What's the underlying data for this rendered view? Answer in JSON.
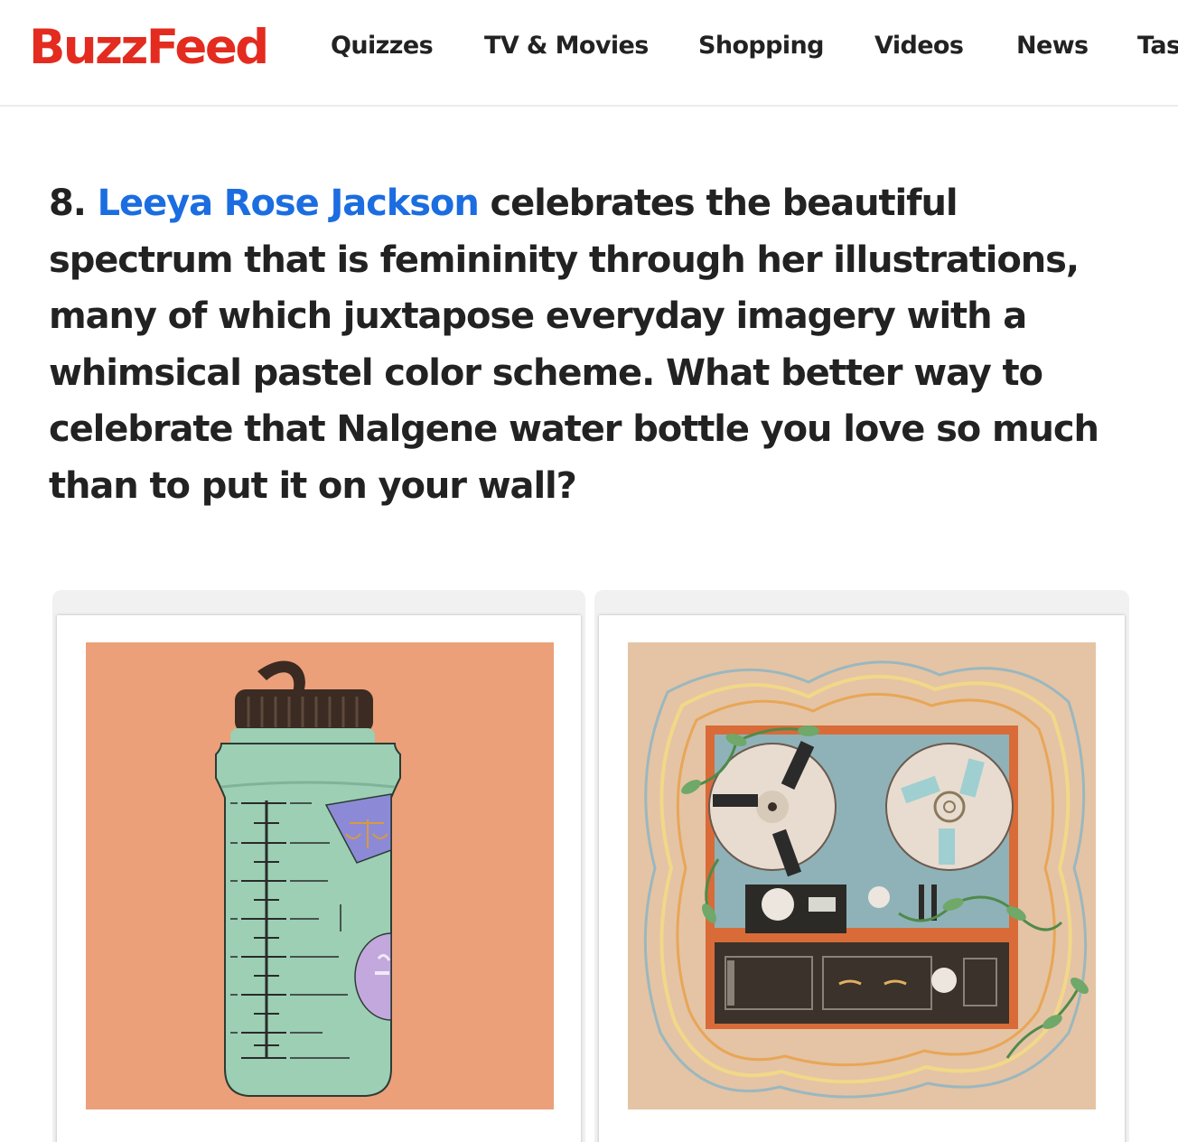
{
  "header": {
    "logo": "BuzzFeed",
    "nav": [
      "Quizzes",
      "TV & Movies",
      "Shopping",
      "Videos",
      "News",
      "Tas"
    ]
  },
  "article": {
    "item_number": "8.",
    "author_link": "Leeya Rose Jackson",
    "text": "celebrates the beautiful spectrum that is femininity through her illustrations, many of which juxtapose everyday imagery with a whimsical pastel color scheme. What better way to celebrate that Nalgene water bottle you love so much than to put it on your wall?"
  },
  "images": [
    {
      "subject": "nalgene-water-bottle-print"
    },
    {
      "subject": "reel-to-reel-tape-recorder-print"
    }
  ],
  "colors": {
    "brand": "#e32b1f",
    "link": "#1b6de0",
    "text": "#222222",
    "print1_background": "#eba07a",
    "print2_background": "#e4c4a4"
  }
}
